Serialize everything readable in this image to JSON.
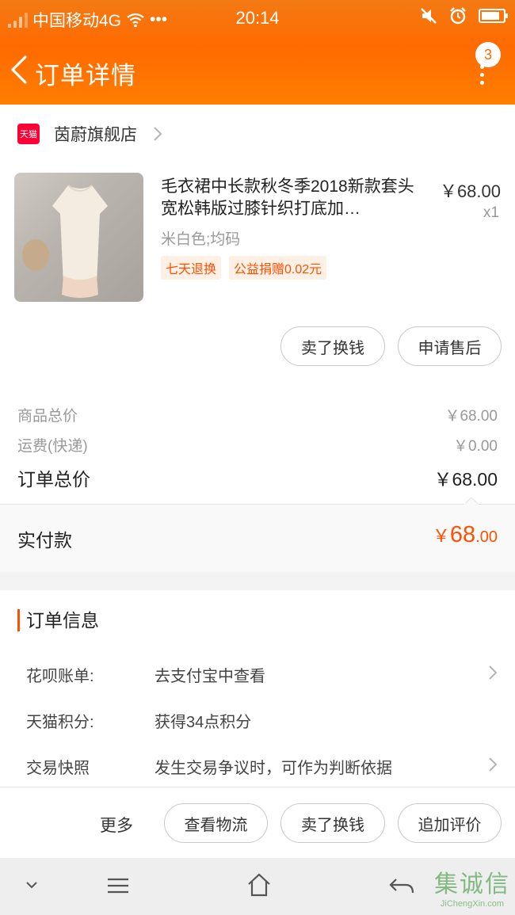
{
  "statusbar": {
    "carrier": "中国移动4G",
    "dots": "•••",
    "time": "20:14"
  },
  "nav": {
    "title": "订单详情",
    "badge_count": "3"
  },
  "shop": {
    "platform_badge": "天猫",
    "name": "茵蔚旗舰店"
  },
  "product": {
    "title": "毛衣裙中长款秋冬季2018新款套头宽松韩版过膝针织打底加…",
    "price": "￥68.00",
    "quantity": "x1",
    "sku": "米白色;均码",
    "tags": [
      "七天退换",
      "公益捐赠0.02元"
    ]
  },
  "item_actions": {
    "sell_label": "卖了换钱",
    "after_sale_label": "申请售后"
  },
  "summary": {
    "goods_label": "商品总价",
    "goods_value": "￥68.00",
    "shipping_label": "运费(快递)",
    "shipping_value": "￥0.00",
    "total_label": "订单总价",
    "total_value": "￥68.00",
    "paid_label": "实付款",
    "paid_symbol": "￥",
    "paid_int": "68",
    "paid_dec": ".00"
  },
  "order_info": {
    "title": "订单信息",
    "rows": [
      {
        "key": "花呗账单:",
        "value": "去支付宝中查看"
      },
      {
        "key": "天猫积分:",
        "value": "获得34点积分"
      },
      {
        "key": "交易快照",
        "value": "发生交易争议时，可作为判断依据"
      }
    ]
  },
  "footer": {
    "more_label": "更多",
    "logistics_label": "查看物流",
    "sell_label": "卖了换钱",
    "review_label": "追加评价"
  },
  "watermark": {
    "text": "集诚信",
    "sub": "JiChengXin.com"
  },
  "colors": {
    "brand_orange": "#ff6a00",
    "price_red": "#ff5000",
    "tmall_red": "#ff0036"
  }
}
